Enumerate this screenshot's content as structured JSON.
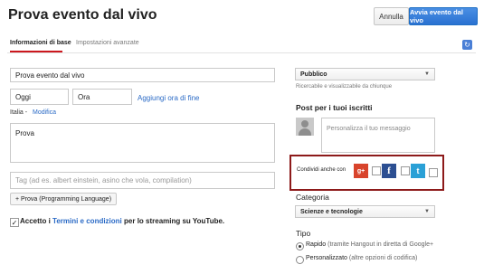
{
  "header": {
    "title": "Prova evento dal vivo",
    "cancel_label": "Annulla",
    "live_label": "Avvia evento dal vivo"
  },
  "tabs": {
    "basic": "Informazioni di base",
    "advanced": "Impostazioni avanzate"
  },
  "form": {
    "title_value": "Prova evento dal vivo",
    "date_value": "Oggi",
    "time_value": "Ora",
    "add_end_time": "Aggiungi ora di fine",
    "timezone": "Italia -",
    "timezone_edit": "Modifica",
    "description_value": "Prova",
    "tags_placeholder": "Tag (ad es. albert einstein, asino che vola, compilation)",
    "tag_chip": "+ Prova (Programming Language)",
    "terms_prefix": "Accetto i",
    "terms_link": "Termini e condizioni",
    "terms_suffix": "per lo streaming su YouTube."
  },
  "sidebar": {
    "privacy_value": "Pubblico",
    "privacy_note": "Ricercabile e visualizzabile da chiunque",
    "subscribers_heading": "Post per i tuoi iscritti",
    "message_placeholder": "Personalizza il tuo messaggio",
    "share_label": "Condividi anche con",
    "social": [
      "g+",
      "f",
      "t"
    ],
    "category_heading": "Categoria",
    "category_value": "Scienze e tecnologie",
    "type_heading": "Tipo",
    "type_options": [
      {
        "label": "Rapido",
        "detail": "(tramite Hangout in diretta di Google+",
        "selected": true
      },
      {
        "label": "Personalizzato",
        "detail": "(altre opzioni di codifica)",
        "selected": false
      }
    ]
  },
  "colors": {
    "accent": "#2a71d1",
    "tab_underline": "#cc181e",
    "highlight_border": "#8d1a1a",
    "google_plus": "#d8442c",
    "facebook": "#2c4f92",
    "twitter": "#2aa0d6"
  },
  "icons": {
    "refresh": "refresh-icon",
    "caret": "chevron-down-icon"
  }
}
